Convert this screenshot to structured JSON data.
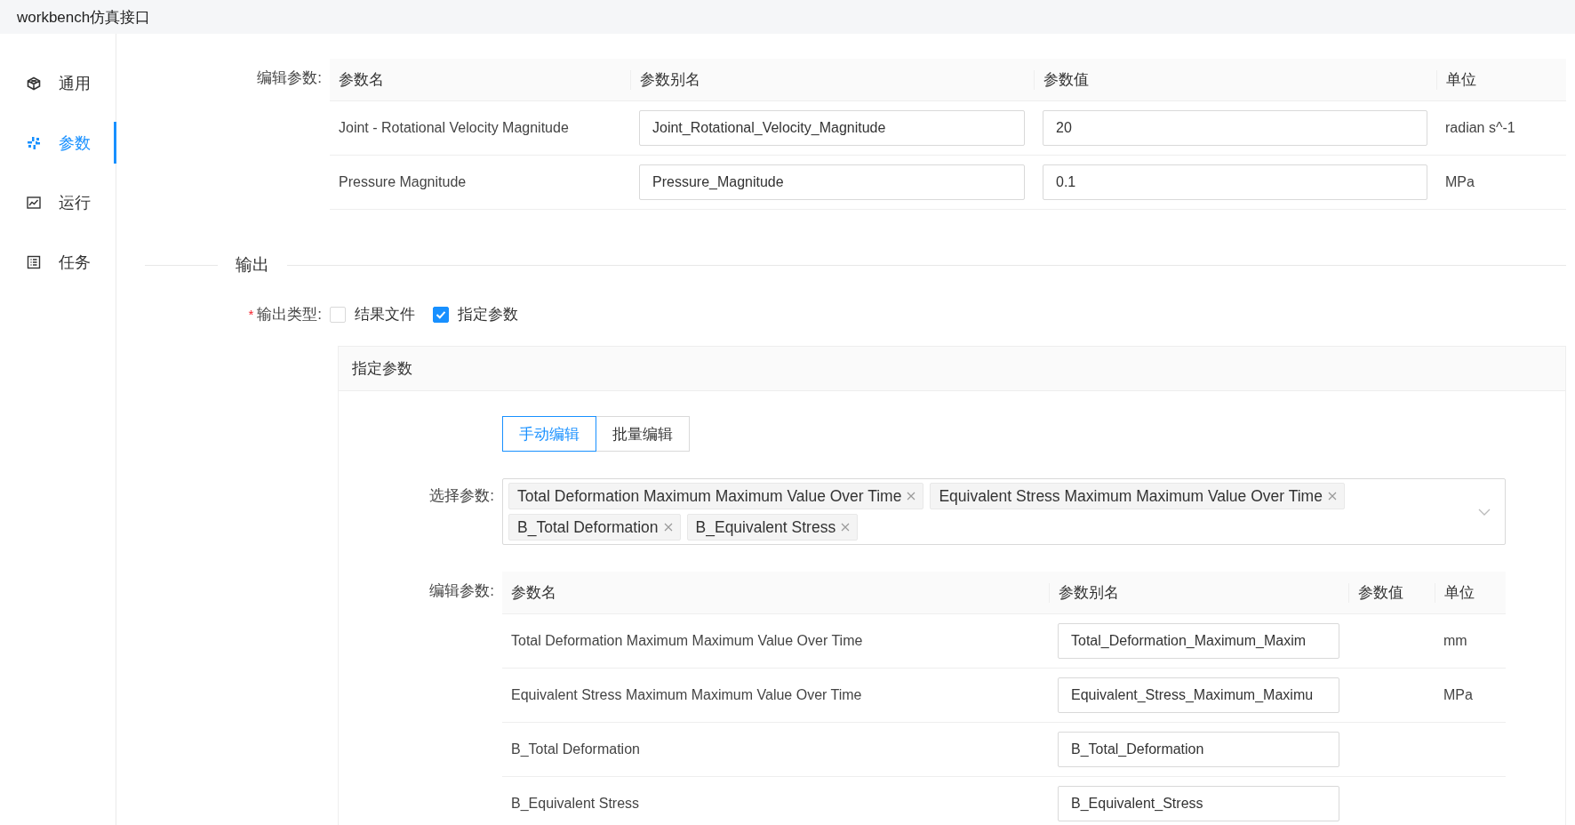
{
  "window": {
    "title": "workbench仿真接口"
  },
  "sidebar": {
    "items": [
      {
        "label": "通用",
        "selected": false
      },
      {
        "label": "参数",
        "selected": true
      },
      {
        "label": "运行",
        "selected": false
      },
      {
        "label": "任务",
        "selected": false
      }
    ]
  },
  "input_params": {
    "label": "编辑参数:",
    "columns": [
      "参数名",
      "参数别名",
      "参数值",
      "单位"
    ],
    "rows": [
      {
        "name": "Joint - Rotational Velocity Magnitude",
        "alias": "Joint_Rotational_Velocity_Magnitude",
        "value": "20",
        "unit": "radian s^-1"
      },
      {
        "name": "Pressure Magnitude",
        "alias": "Pressure_Magnitude",
        "value": "0.1",
        "unit": "MPa"
      }
    ]
  },
  "output": {
    "divider": "输出",
    "type_field": {
      "required_mark": "*",
      "label": "输出类型:",
      "options": [
        {
          "label": "结果文件",
          "checked": false
        },
        {
          "label": "指定参数",
          "checked": true
        }
      ]
    },
    "panel": {
      "title": "指定参数",
      "modes": [
        {
          "label": "手动编辑",
          "selected": true
        },
        {
          "label": "批量编辑",
          "selected": false
        }
      ],
      "select": {
        "label": "选择参数:",
        "tags": [
          "Total Deformation Maximum Maximum Value Over Time",
          "Equivalent Stress Maximum Maximum Value Over Time",
          "B_Total Deformation",
          "B_Equivalent Stress"
        ]
      },
      "edit": {
        "label": "编辑参数:",
        "columns": [
          "参数名",
          "参数别名",
          "参数值",
          "单位"
        ],
        "rows": [
          {
            "name": "Total Deformation Maximum Maximum Value Over Time",
            "alias": "Total_Deformation_Maximum_Maxim",
            "unit": "mm"
          },
          {
            "name": "Equivalent Stress Maximum Maximum Value Over Time",
            "alias": "Equivalent_Stress_Maximum_Maximu",
            "unit": "MPa"
          },
          {
            "name": "B_Total Deformation",
            "alias": "B_Total_Deformation"
          },
          {
            "name": "B_Equivalent Stress",
            "alias": "B_Equivalent_Stress"
          }
        ]
      }
    }
  }
}
